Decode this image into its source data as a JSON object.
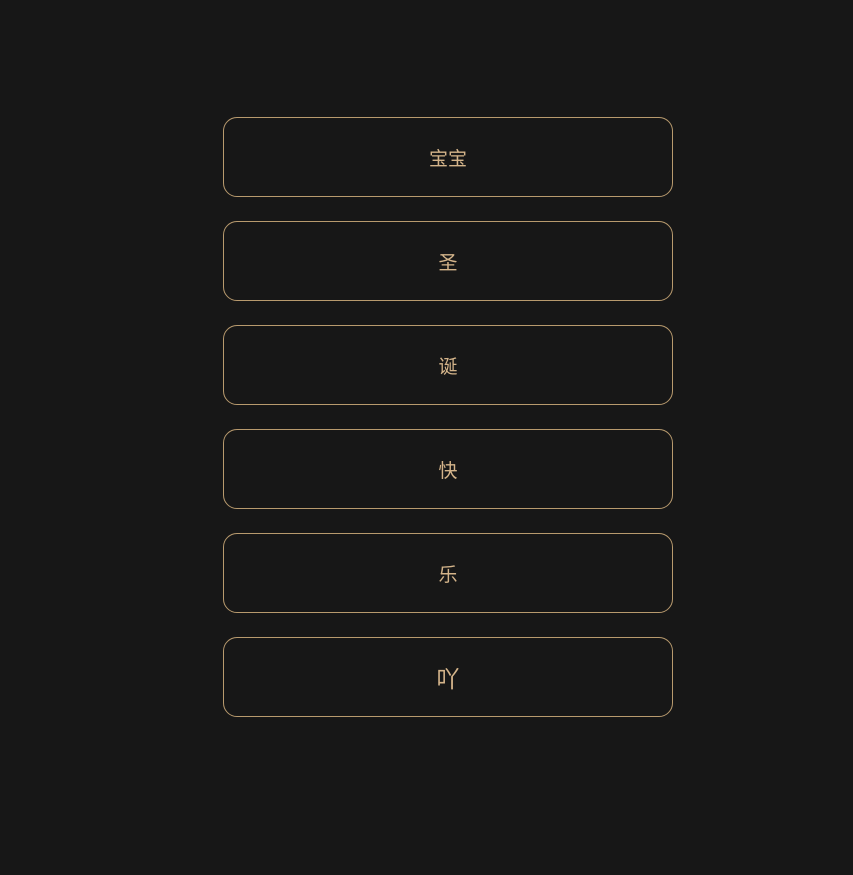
{
  "colors": {
    "background": "#171717",
    "border": "#b89a6e",
    "text": "#d4b48a"
  },
  "cards": [
    {
      "label": "宝宝"
    },
    {
      "label": "圣"
    },
    {
      "label": "诞"
    },
    {
      "label": "快"
    },
    {
      "label": "乐"
    }
  ],
  "final_button": {
    "label": "吖"
  }
}
